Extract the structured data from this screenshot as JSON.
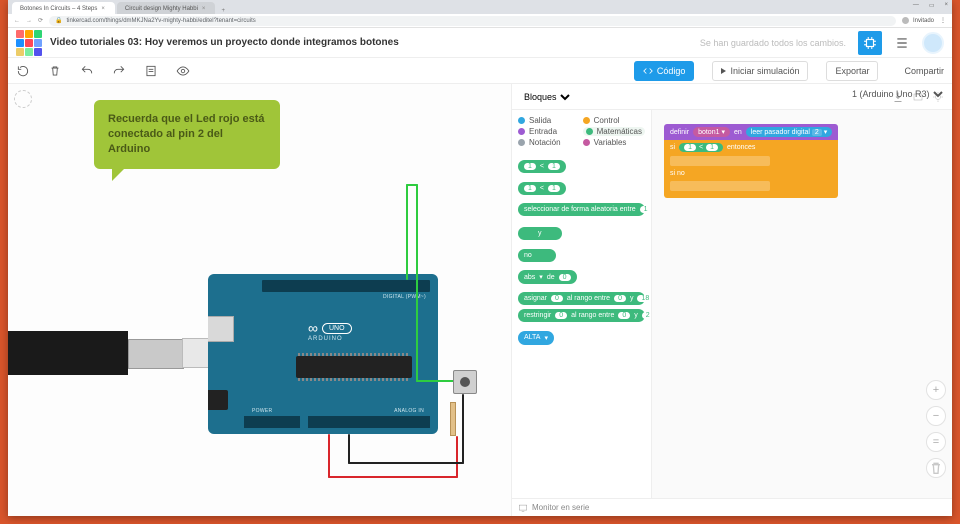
{
  "browser": {
    "tabs": [
      {
        "label": "Botones In Circuits – 4 Steps"
      },
      {
        "label": "Circuit design Mighty Habbi"
      }
    ],
    "url": "tinkercad.com/things/dmMKJNa2Yv-mighty-habbi/editel?tenant=circuits",
    "profile": "Invitado"
  },
  "header": {
    "title": "Video tutoriales 03: Hoy veremos un proyecto donde integramos botones",
    "save_status": "Se han guardado todos los cambios."
  },
  "toolbar": {
    "code": "Código",
    "simulate": "Iniciar simulación",
    "export": "Exportar",
    "share": "Compartir"
  },
  "canvas": {
    "hint": "Recuerda que el Led rojo está conectado al pin 2 del Arduino",
    "board_brand": "ARDUINO",
    "board_model": "UNO",
    "label_digital": "DIGITAL (PWM~)",
    "label_power": "POWER",
    "label_analog": "ANALOG IN"
  },
  "code_panel": {
    "mode": "Bloques",
    "component": "1 (Arduino Uno R3)",
    "categories": {
      "salida": "Salida",
      "entrada": "Entrada",
      "control": "Control",
      "matematicas": "Matemáticas",
      "notacion": "Notación",
      "variables": "Variables"
    },
    "palette_blocks": {
      "cmp": {
        "a": "1",
        "op": "<",
        "b": "1"
      },
      "lt": {
        "a": "1",
        "op": "<",
        "b": "1"
      },
      "rand": {
        "label": "seleccionar de forma aleatoria entre",
        "a": "1"
      },
      "and": "y",
      "not": "no",
      "abs": {
        "fn": "abs",
        "of_lbl": "de",
        "v": "0"
      },
      "map": {
        "lbl": "asignar",
        "v": "0",
        "mid": "al rango entre",
        "a": "0",
        "y": "y",
        "b": "18"
      },
      "constrain": {
        "lbl": "restringir",
        "v": "0",
        "mid": "al rango entre",
        "a": "0",
        "y": "y",
        "b": "2"
      },
      "if_alt": "ALTA"
    },
    "workspace": {
      "define": {
        "kw": "definir",
        "var": "boton1",
        "as": "en",
        "read": "leer pasador digital",
        "pin": "2"
      },
      "if": {
        "kw": "si",
        "a": "1",
        "op": "<",
        "b": "1",
        "then": "entonces",
        "else": "si no"
      }
    },
    "monitor": "Monitor en serie"
  }
}
